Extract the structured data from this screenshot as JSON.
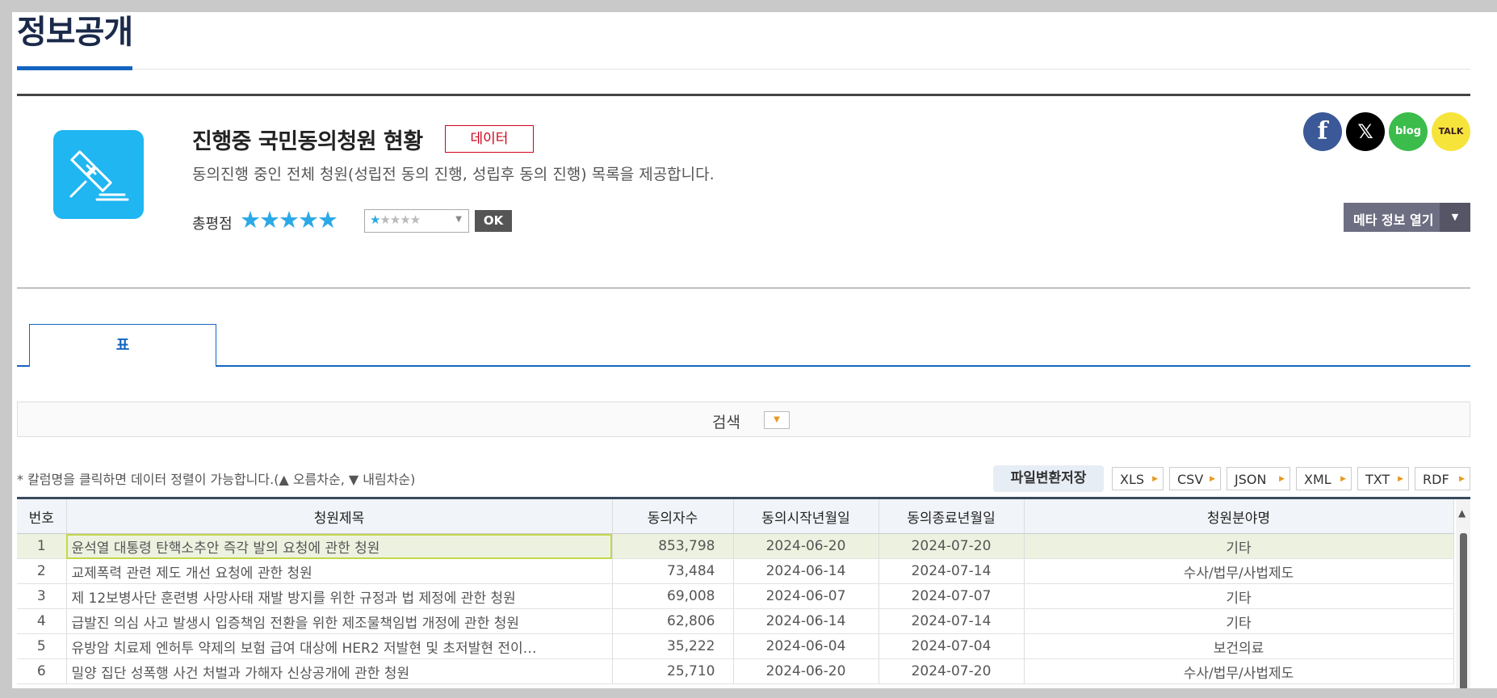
{
  "page": {
    "title": "정보공개"
  },
  "dataset": {
    "title": "진행중 국민동의청원 현황",
    "badge": "데이터",
    "description": "동의진행 중인 전체 청원(성립전 동의 진행, 성립후 동의 진행) 목록을 제공합니다.",
    "rating_label": "총평점",
    "rating_stars": "★★★★★",
    "rating_select_stars_on": "★",
    "rating_select_stars_off": "★★★★",
    "ok_label": "OK",
    "meta_button": "메타 정보 열기",
    "icon": "gavel-icon"
  },
  "share": {
    "facebook": "f",
    "x": "𝕏",
    "blog": "blog",
    "talk": "TALK"
  },
  "tabs": [
    {
      "label": "표"
    }
  ],
  "search": {
    "label": "검색"
  },
  "table_toolbar": {
    "hint": "* 칼럼명을 클릭하면 데이터 정렬이 가능합니다.(▲ 오름차순, ▼ 내림차순)",
    "save_label": "파일변환저장",
    "formats": [
      "XLS",
      "CSV",
      "JSON",
      "XML",
      "TXT",
      "RDF"
    ]
  },
  "table": {
    "columns": [
      "번호",
      "청원제목",
      "동의자수",
      "동의시작년월일",
      "동의종료년월일",
      "청원분야명"
    ],
    "rows": [
      [
        "1",
        "윤석열 대통령 탄핵소추안 즉각 발의 요청에 관한 청원",
        "853,798",
        "2024-06-20",
        "2024-07-20",
        "기타"
      ],
      [
        "2",
        "교제폭력 관련 제도 개선 요청에 관한 청원",
        "73,484",
        "2024-06-14",
        "2024-07-14",
        "수사/법무/사법제도"
      ],
      [
        "3",
        "제 12보병사단 훈련병 사망사태 재발 방지를 위한 규정과 법 제정에 관한 청원",
        "69,008",
        "2024-06-07",
        "2024-07-07",
        "기타"
      ],
      [
        "4",
        "급발진 의심 사고 발생시 입증책임 전환을 위한 제조물책임법 개정에 관한 청원",
        "62,806",
        "2024-06-14",
        "2024-07-14",
        "기타"
      ],
      [
        "5",
        "유방암 치료제 엔허투 약제의 보험 급여 대상에 HER2 저발현 및 초저발현 전이…",
        "35,222",
        "2024-06-04",
        "2024-07-04",
        "보건의료"
      ],
      [
        "6",
        "밀양 집단 성폭행 사건 처벌과 가해자 신상공개에 관한 청원",
        "25,710",
        "2024-06-20",
        "2024-07-20",
        "수사/법무/사법제도"
      ]
    ]
  },
  "colors": {
    "accent": "#1565c0",
    "icon_bg": "#1fb6f1",
    "badge": "#d0021b",
    "star": "#2ba9e6",
    "selected_row": "#edf2e0"
  }
}
